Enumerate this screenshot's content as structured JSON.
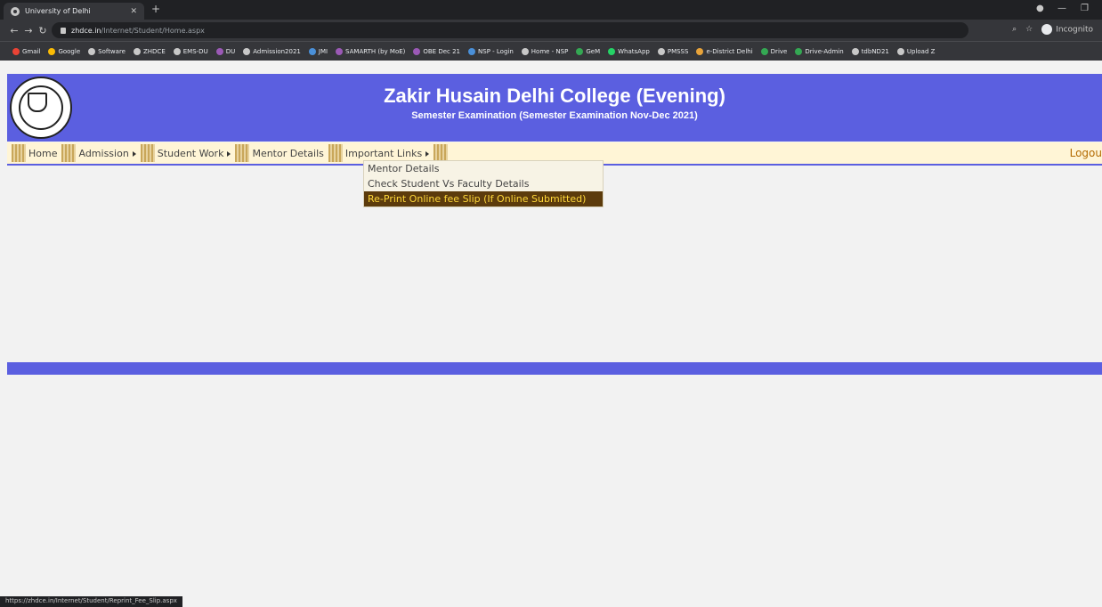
{
  "browser": {
    "tab_title": "University of Delhi",
    "url_domain": "zhdce.in",
    "url_path": "/Internet/Student/Home.aspx",
    "incognito_label": "Incognito",
    "bookmarks": [
      {
        "label": "Gmail",
        "color": "#ea4335"
      },
      {
        "label": "Google",
        "color": "#fbbc05"
      },
      {
        "label": "Software",
        "color": "#c8c8c8"
      },
      {
        "label": "ZHDCE",
        "color": "#c8c8c8"
      },
      {
        "label": "EMS-DU",
        "color": "#c8c8c8"
      },
      {
        "label": "DU",
        "color": "#9b59b6"
      },
      {
        "label": "Admission2021",
        "color": "#c8c8c8"
      },
      {
        "label": "JMI",
        "color": "#4a90d9"
      },
      {
        "label": "SAMARTH (by MoE)",
        "color": "#9b59b6"
      },
      {
        "label": "OBE Dec 21",
        "color": "#9b59b6"
      },
      {
        "label": "NSP - Login",
        "color": "#4a90d9"
      },
      {
        "label": "Home - NSP",
        "color": "#c8c8c8"
      },
      {
        "label": "GeM",
        "color": "#34a853"
      },
      {
        "label": "WhatsApp",
        "color": "#25d366"
      },
      {
        "label": "PMSSS",
        "color": "#c8c8c8"
      },
      {
        "label": "e-District Delhi",
        "color": "#e8a33a"
      },
      {
        "label": "Drive",
        "color": "#34a853"
      },
      {
        "label": "Drive-Admin",
        "color": "#34a853"
      },
      {
        "label": "tdbND21",
        "color": "#c8c8c8"
      },
      {
        "label": "Upload Z",
        "color": "#c8c8c8"
      }
    ],
    "status_url": "https://zhdce.in/Internet/Student/Reprint_Fee_Slip.aspx"
  },
  "header": {
    "title": "Zakir Husain Delhi College (Evening)",
    "subtitle": "Semester Examination (Semester Examination Nov-Dec 2021)"
  },
  "menu": {
    "items": [
      "Home",
      "Admission",
      "Student Work",
      "Mentor Details",
      "Important Links"
    ],
    "logout": "Logou"
  },
  "dropdown": {
    "items": [
      "Mentor Details",
      "Check Student Vs Faculty Details",
      "Re-Print Online fee Slip (If Online Submitted)"
    ]
  },
  "colors": {
    "header_bg": "#5b5fe0",
    "menu_bg": "#fff5d6",
    "highlight_bg": "#5c3b0c",
    "highlight_text": "#ffd83a"
  }
}
